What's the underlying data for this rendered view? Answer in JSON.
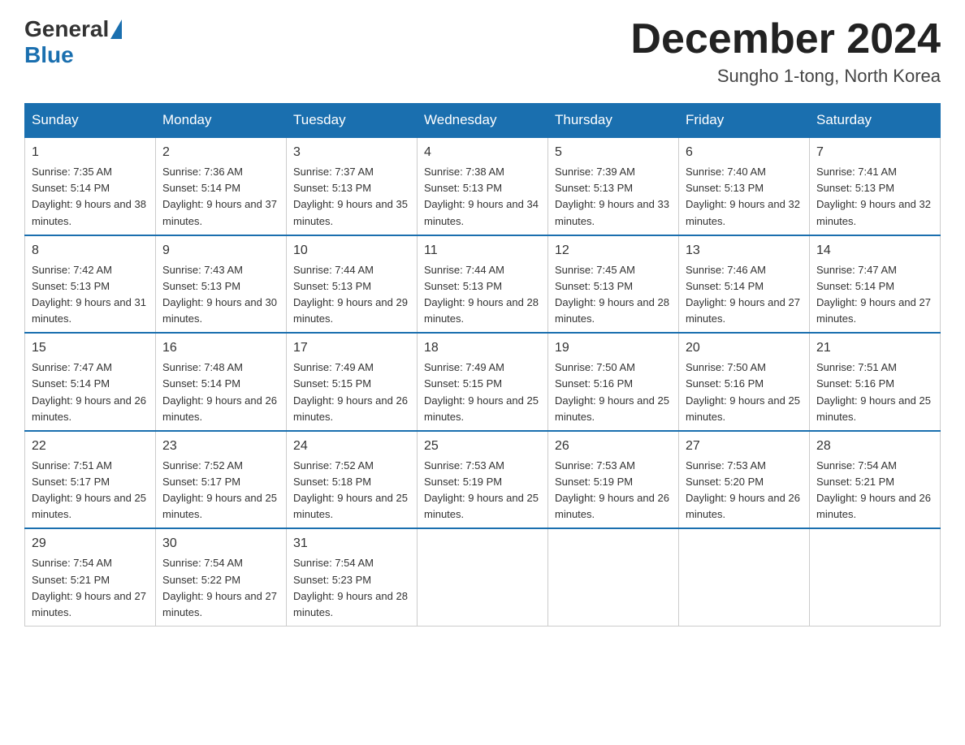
{
  "header": {
    "logo_general": "General",
    "logo_blue": "Blue",
    "month_title": "December 2024",
    "location": "Sungho 1-tong, North Korea"
  },
  "days_of_week": [
    "Sunday",
    "Monday",
    "Tuesday",
    "Wednesday",
    "Thursday",
    "Friday",
    "Saturday"
  ],
  "weeks": [
    [
      {
        "day": "1",
        "sunrise": "7:35 AM",
        "sunset": "5:14 PM",
        "daylight": "9 hours and 38 minutes."
      },
      {
        "day": "2",
        "sunrise": "7:36 AM",
        "sunset": "5:14 PM",
        "daylight": "9 hours and 37 minutes."
      },
      {
        "day": "3",
        "sunrise": "7:37 AM",
        "sunset": "5:13 PM",
        "daylight": "9 hours and 35 minutes."
      },
      {
        "day": "4",
        "sunrise": "7:38 AM",
        "sunset": "5:13 PM",
        "daylight": "9 hours and 34 minutes."
      },
      {
        "day": "5",
        "sunrise": "7:39 AM",
        "sunset": "5:13 PM",
        "daylight": "9 hours and 33 minutes."
      },
      {
        "day": "6",
        "sunrise": "7:40 AM",
        "sunset": "5:13 PM",
        "daylight": "9 hours and 32 minutes."
      },
      {
        "day": "7",
        "sunrise": "7:41 AM",
        "sunset": "5:13 PM",
        "daylight": "9 hours and 32 minutes."
      }
    ],
    [
      {
        "day": "8",
        "sunrise": "7:42 AM",
        "sunset": "5:13 PM",
        "daylight": "9 hours and 31 minutes."
      },
      {
        "day": "9",
        "sunrise": "7:43 AM",
        "sunset": "5:13 PM",
        "daylight": "9 hours and 30 minutes."
      },
      {
        "day": "10",
        "sunrise": "7:44 AM",
        "sunset": "5:13 PM",
        "daylight": "9 hours and 29 minutes."
      },
      {
        "day": "11",
        "sunrise": "7:44 AM",
        "sunset": "5:13 PM",
        "daylight": "9 hours and 28 minutes."
      },
      {
        "day": "12",
        "sunrise": "7:45 AM",
        "sunset": "5:13 PM",
        "daylight": "9 hours and 28 minutes."
      },
      {
        "day": "13",
        "sunrise": "7:46 AM",
        "sunset": "5:14 PM",
        "daylight": "9 hours and 27 minutes."
      },
      {
        "day": "14",
        "sunrise": "7:47 AM",
        "sunset": "5:14 PM",
        "daylight": "9 hours and 27 minutes."
      }
    ],
    [
      {
        "day": "15",
        "sunrise": "7:47 AM",
        "sunset": "5:14 PM",
        "daylight": "9 hours and 26 minutes."
      },
      {
        "day": "16",
        "sunrise": "7:48 AM",
        "sunset": "5:14 PM",
        "daylight": "9 hours and 26 minutes."
      },
      {
        "day": "17",
        "sunrise": "7:49 AM",
        "sunset": "5:15 PM",
        "daylight": "9 hours and 26 minutes."
      },
      {
        "day": "18",
        "sunrise": "7:49 AM",
        "sunset": "5:15 PM",
        "daylight": "9 hours and 25 minutes."
      },
      {
        "day": "19",
        "sunrise": "7:50 AM",
        "sunset": "5:16 PM",
        "daylight": "9 hours and 25 minutes."
      },
      {
        "day": "20",
        "sunrise": "7:50 AM",
        "sunset": "5:16 PM",
        "daylight": "9 hours and 25 minutes."
      },
      {
        "day": "21",
        "sunrise": "7:51 AM",
        "sunset": "5:16 PM",
        "daylight": "9 hours and 25 minutes."
      }
    ],
    [
      {
        "day": "22",
        "sunrise": "7:51 AM",
        "sunset": "5:17 PM",
        "daylight": "9 hours and 25 minutes."
      },
      {
        "day": "23",
        "sunrise": "7:52 AM",
        "sunset": "5:17 PM",
        "daylight": "9 hours and 25 minutes."
      },
      {
        "day": "24",
        "sunrise": "7:52 AM",
        "sunset": "5:18 PM",
        "daylight": "9 hours and 25 minutes."
      },
      {
        "day": "25",
        "sunrise": "7:53 AM",
        "sunset": "5:19 PM",
        "daylight": "9 hours and 25 minutes."
      },
      {
        "day": "26",
        "sunrise": "7:53 AM",
        "sunset": "5:19 PM",
        "daylight": "9 hours and 26 minutes."
      },
      {
        "day": "27",
        "sunrise": "7:53 AM",
        "sunset": "5:20 PM",
        "daylight": "9 hours and 26 minutes."
      },
      {
        "day": "28",
        "sunrise": "7:54 AM",
        "sunset": "5:21 PM",
        "daylight": "9 hours and 26 minutes."
      }
    ],
    [
      {
        "day": "29",
        "sunrise": "7:54 AM",
        "sunset": "5:21 PM",
        "daylight": "9 hours and 27 minutes."
      },
      {
        "day": "30",
        "sunrise": "7:54 AM",
        "sunset": "5:22 PM",
        "daylight": "9 hours and 27 minutes."
      },
      {
        "day": "31",
        "sunrise": "7:54 AM",
        "sunset": "5:23 PM",
        "daylight": "9 hours and 28 minutes."
      },
      null,
      null,
      null,
      null
    ]
  ]
}
